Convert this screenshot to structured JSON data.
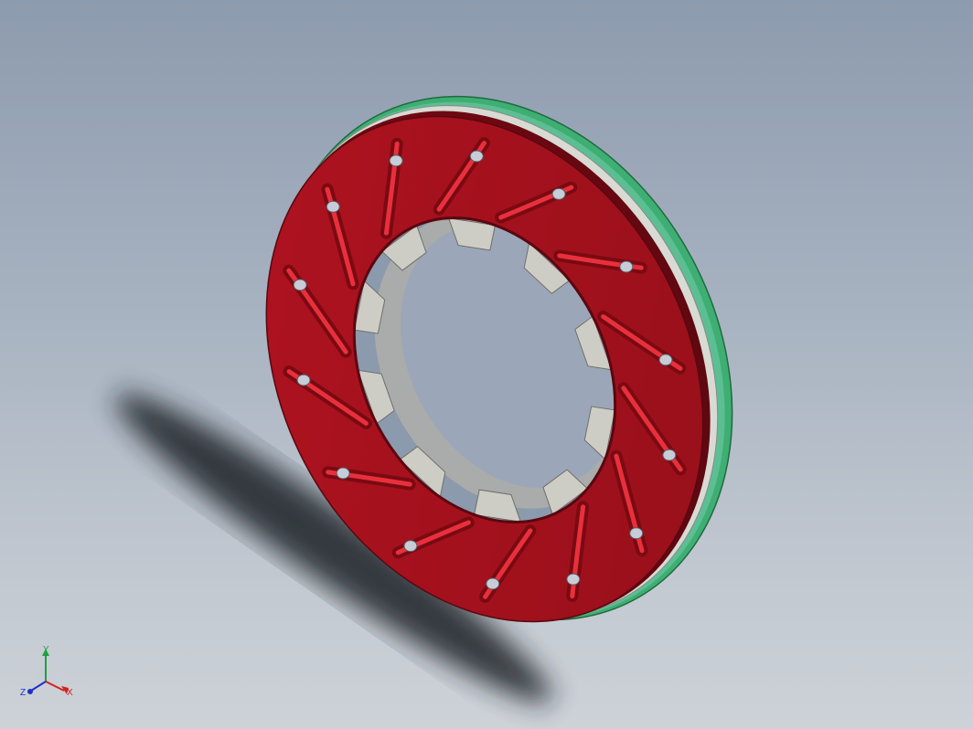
{
  "viewport": {
    "background_top": "#8d9bae",
    "background_bottom": "#cdd2d8"
  },
  "model": {
    "disc_face_color": "#a0101a",
    "slot_highlight_color": "#e8303c",
    "backing_plate_color": "#3fae72",
    "backing_edge_highlight": "#8fe0d0",
    "bell_tab_color": "#cdcdc6",
    "pin_color": "#c8ccd6",
    "shadow_color": "#2a2e36"
  },
  "triad": {
    "x_label": "X",
    "y_label": "Y",
    "z_label": "Z",
    "x_color": "#d42020",
    "y_color": "#20a040",
    "z_color": "#2030c8"
  }
}
